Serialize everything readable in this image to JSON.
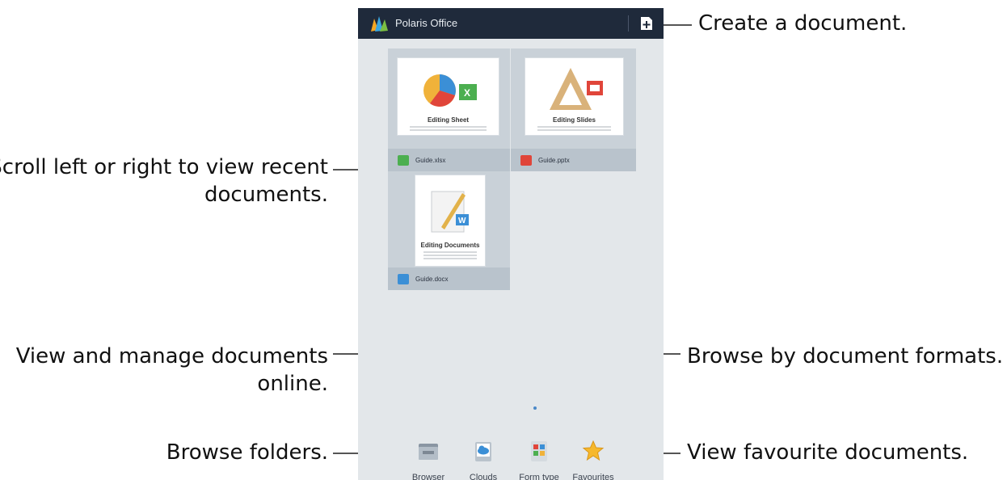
{
  "app": {
    "title": "Polaris Office"
  },
  "recent_documents": [
    {
      "thumb_title": "Editing Sheet",
      "filename": "Guide.xlsx",
      "type": "xlsx",
      "color": "#4caf50"
    },
    {
      "thumb_title": "Editing Slides",
      "filename": "Guide.pptx",
      "type": "pptx",
      "color": "#e0453a"
    },
    {
      "thumb_title": "Editing Documents",
      "filename": "Guide.docx",
      "type": "docx",
      "color": "#3b8fd6"
    }
  ],
  "bottom_nav": [
    {
      "label": "Browser",
      "icon": "folder-icon"
    },
    {
      "label": "Clouds",
      "icon": "cloud-icon"
    },
    {
      "label": "Form type",
      "icon": "form-type-icon"
    },
    {
      "label": "Favourites",
      "icon": "star-icon"
    }
  ],
  "callouts": {
    "create": "Create a document.",
    "scroll_line1": "Scroll left or right to view recent",
    "scroll_line2": "documents.",
    "online_line1": "View and manage documents",
    "online_line2": "online.",
    "folders": "Browse folders.",
    "formats": "Browse by document formats.",
    "favourites": "View favourite documents."
  },
  "colors": {
    "titlebar": "#1f2a3b",
    "content_bg": "#e3e7ea",
    "card_bg": "#c9d1d8"
  }
}
